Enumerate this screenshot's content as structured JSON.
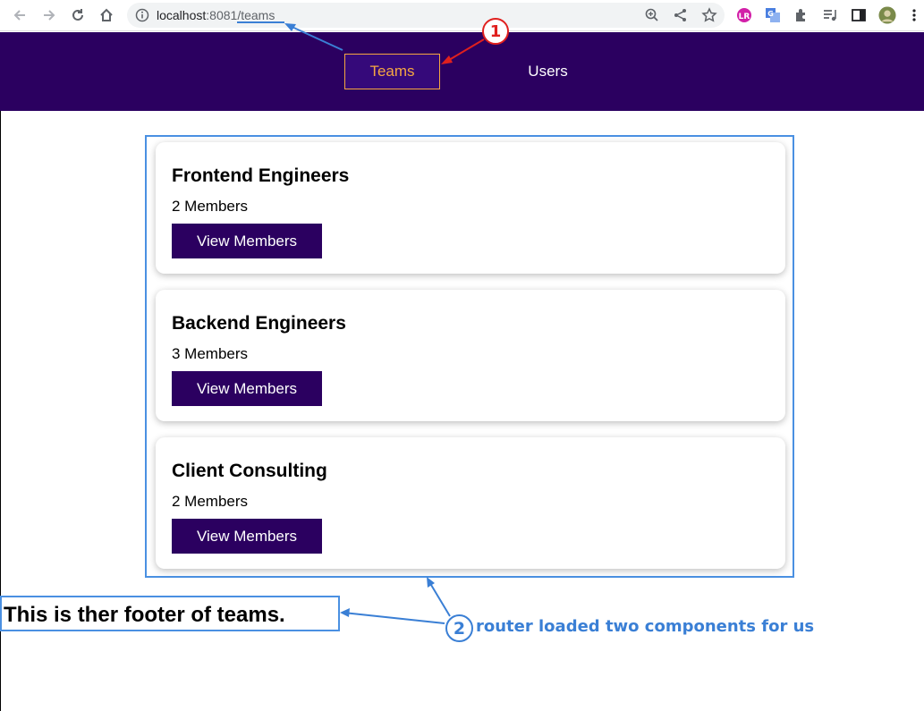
{
  "browser": {
    "url_host": "localhost",
    "url_port": ":8081",
    "url_path": "/teams"
  },
  "nav": {
    "items": [
      {
        "label": "Teams",
        "active": true
      },
      {
        "label": "Users",
        "active": false
      }
    ]
  },
  "teams": [
    {
      "name": "Frontend Engineers",
      "members": "2 Members",
      "button": "View Members"
    },
    {
      "name": "Backend Engineers",
      "members": "3 Members",
      "button": "View Members"
    },
    {
      "name": "Client Consulting",
      "members": "2 Members",
      "button": "View Members"
    }
  ],
  "footer": {
    "text": "This is ther footer of teams."
  },
  "annotations": {
    "marker_one": "1",
    "marker_two": "2",
    "note": "router loaded two components for us",
    "colors": {
      "red": "#e0201e",
      "blue": "#3a7fd5"
    }
  },
  "colors": {
    "header_bg": "#2b0060",
    "active_nav": "#f5a742",
    "button_bg": "#2b0060"
  }
}
